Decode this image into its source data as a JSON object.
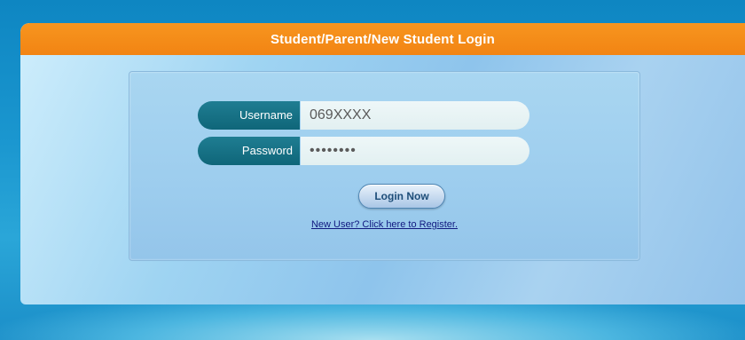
{
  "header": {
    "title": "Student/Parent/New Student Login"
  },
  "form": {
    "username_label": "Username",
    "username_value": "069XXXX",
    "password_label": "Password",
    "password_value": "••••••••",
    "login_button_label": "Login Now",
    "register_link_text": "New User? Click here to Register."
  },
  "colors": {
    "header_orange": "#f28413",
    "label_teal": "#0f6679",
    "page_blue": "#1a96cf"
  }
}
